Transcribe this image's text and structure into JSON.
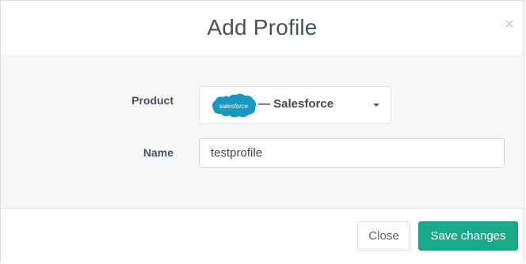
{
  "modal": {
    "title": "Add Profile",
    "close_glyph": "×"
  },
  "form": {
    "product": {
      "label": "Product",
      "logo_text": "salesforce",
      "logo_icon": "salesforce-cloud-icon",
      "selected_value": "— Salesforce",
      "caret_icon": "caret-down-icon"
    },
    "name": {
      "label": "Name",
      "value": "testprofile"
    }
  },
  "footer": {
    "close_label": "Close",
    "save_label": "Save changes"
  },
  "colors": {
    "brand_salesforce": "#1798c1",
    "primary_button": "#1aaa8a"
  }
}
